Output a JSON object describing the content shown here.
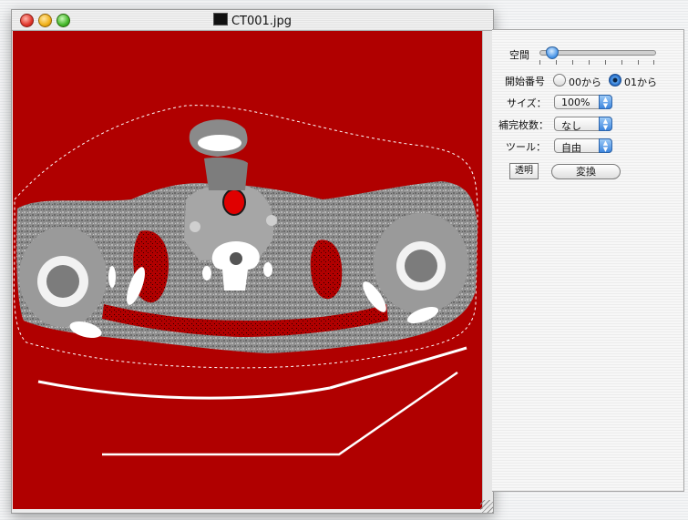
{
  "window": {
    "title": "CT001.jpg",
    "icon": "image-file-icon"
  },
  "panel": {
    "spacing_label": "空間",
    "start_label": "開始番号",
    "start_options": [
      {
        "label": "00から",
        "selected": false
      },
      {
        "label": "01から",
        "selected": true
      }
    ],
    "size_label": "サイズ：",
    "size_value": "100%",
    "interp_label": "補完枚数：",
    "interp_value": "なし",
    "tool_label": "ツール：",
    "tool_value": "自由",
    "transparent_button": "透明",
    "convert_button": "変換",
    "slider_value": 0.1
  },
  "colors": {
    "canvas_background": "#b00000",
    "accent": "#3d86de"
  }
}
